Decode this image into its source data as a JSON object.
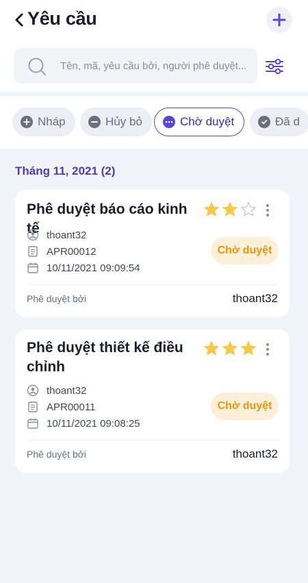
{
  "header": {
    "title": "Yêu cầu"
  },
  "search": {
    "placeholder": "Tên, mã, yêu cầu bởi, người phê duyệt..."
  },
  "filters": [
    {
      "label": "Nháp",
      "icon": "plus-circle-icon",
      "active": false
    },
    {
      "label": "Hủy bỏ",
      "icon": "minus-circle-icon",
      "active": false
    },
    {
      "label": "Chờ duyệt",
      "icon": "more-circle-icon",
      "active": true
    },
    {
      "label": "Đã d",
      "icon": "check-circle-icon",
      "active": false
    }
  ],
  "section": {
    "month_label": "Tháng 11, 2021 (2)"
  },
  "requests": [
    {
      "title": "Phê duyệt báo cáo kinh tế",
      "rating": 2,
      "max_rating": 3,
      "user": "thoant32",
      "code": "APR00012",
      "datetime": "10/11/2021 09:09:54",
      "status": "Chờ duyệt",
      "approved_by_label": "Phê duyệt bởi",
      "approved_by": "thoant32"
    },
    {
      "title": "Phê duyệt thiết kế điều chỉnh",
      "rating": 3,
      "max_rating": 3,
      "user": "thoant32",
      "code": "APR00011",
      "datetime": "10/11/2021 09:08:25",
      "status": "Chờ duyệt",
      "approved_by_label": "Phê duyệt bởi",
      "approved_by": "thoant32"
    }
  ],
  "colors": {
    "accent": "#5b44d6",
    "status_bg": "#fdf0d9",
    "status_text": "#e8960f",
    "star": "#f7c948"
  }
}
